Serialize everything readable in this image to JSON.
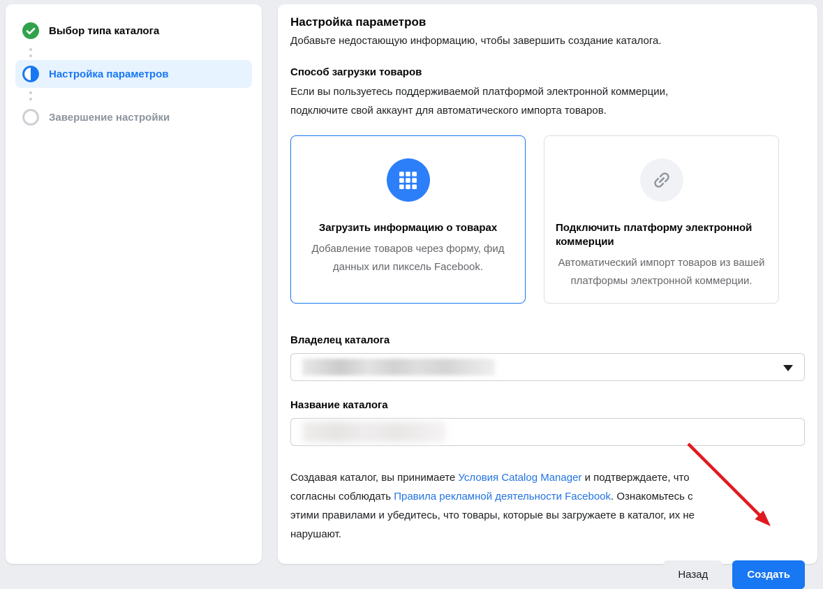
{
  "colors": {
    "accent_blue": "#1877f2",
    "success_green": "#31a24c",
    "active_step_bg": "#e7f3ff",
    "link_blue": "#2374e1",
    "annotation_red": "#e0191f",
    "page_background": "#ebedf0"
  },
  "wizard_sidebar": {
    "steps": [
      {
        "label": "Выбор типа каталога",
        "state": "completed",
        "icon": "check-icon"
      },
      {
        "label": "Настройка параметров",
        "state": "current",
        "icon": "half-progress-icon"
      },
      {
        "label": "Завершение настройки",
        "state": "upcoming",
        "icon": "empty-circle-icon"
      }
    ]
  },
  "main": {
    "title": "Настройка параметров",
    "subtitle": "Добавьте недостающую информацию, чтобы завершить создание каталога.",
    "upload_section": {
      "heading": "Способ загрузки товаров",
      "description": "Если вы пользуетесь поддерживаемой платформой электронной коммерции, подключите свой аккаунт для автоматического импорта товаров.",
      "cards": [
        {
          "title": "Загрузить информацию о товарах",
          "description": "Добавление товаров через форму, фид данных или пиксель Facebook.",
          "icon": "grid-icon",
          "selected": true
        },
        {
          "title": "Подключить платформу электронной коммерции",
          "description": "Автоматический импорт товаров из вашей платформы электронной коммерции.",
          "icon": "link-icon",
          "selected": false
        }
      ]
    },
    "owner_field": {
      "label": "Владелец каталога",
      "value_redacted": true
    },
    "name_field": {
      "label": "Название каталога",
      "value_redacted": true
    },
    "terms": {
      "text_before_link1": "Создавая каталог, вы принимаете ",
      "link1": "Условия Catalog Manager",
      "text_between_links": " и подтверждаете, что согласны соблюдать ",
      "link2": "Правила рекламной деятельности Facebook",
      "text_after_link2": ". Ознакомьтесь с этими правилами и убедитесь, что товары, которые вы загружаете в каталог, их не нарушают."
    },
    "footer": {
      "back_label": "Назад",
      "create_label": "Создать"
    }
  },
  "annotation": {
    "shape": "red-arrow",
    "points_to": "create-button"
  }
}
